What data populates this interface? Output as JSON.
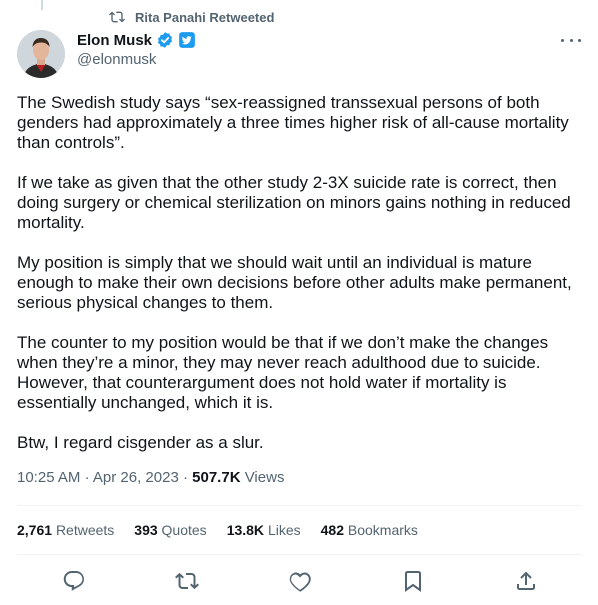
{
  "retweet_context": {
    "text": "Rita Panahi Retweeted"
  },
  "author": {
    "name": "Elon Musk",
    "handle": "@elonmusk"
  },
  "tweet": {
    "paragraphs": [
      "The Swedish study says “sex-reassigned transsexual persons of both genders had approximately a three times higher risk of all-cause mortality than controls”.",
      "If we take as given that the other study 2-3X suicide rate is correct, then doing surgery or chemical sterilization on minors gains nothing in reduced mortality.",
      "My position is simply that we should wait until an individual is mature enough to make their own decisions before other adults make permanent, serious physical changes to them.",
      "The counter to my position would be that if we don’t make the changes when they’re a minor, they may never reach adulthood due to suicide. However, that counterargument does not hold water if mortality is essentially unchanged, which it is.",
      "Btw, I regard cisgender as a slur."
    ]
  },
  "meta": {
    "time": "10:25 AM",
    "separator": "·",
    "date": "Apr 26, 2023",
    "views_count": "507.7K",
    "views_label": "Views"
  },
  "stats": {
    "retweets_count": "2,761",
    "retweets_label": "Retweets",
    "quotes_count": "393",
    "quotes_label": "Quotes",
    "likes_count": "13.8K",
    "likes_label": "Likes",
    "bookmarks_count": "482",
    "bookmarks_label": "Bookmarks"
  },
  "icons": {
    "retweet_context": "retweet-icon",
    "verified": "verified-badge-icon",
    "affiliation": "twitter-bird-badge-icon",
    "more": "more-icon",
    "reply": "reply-icon",
    "retweet": "retweet-icon",
    "like": "heart-icon",
    "bookmark": "bookmark-icon",
    "share": "share-icon"
  },
  "colors": {
    "text": "#0f1419",
    "secondary": "#536471",
    "accent": "#1d9bf0",
    "divider": "#eff3f4"
  }
}
